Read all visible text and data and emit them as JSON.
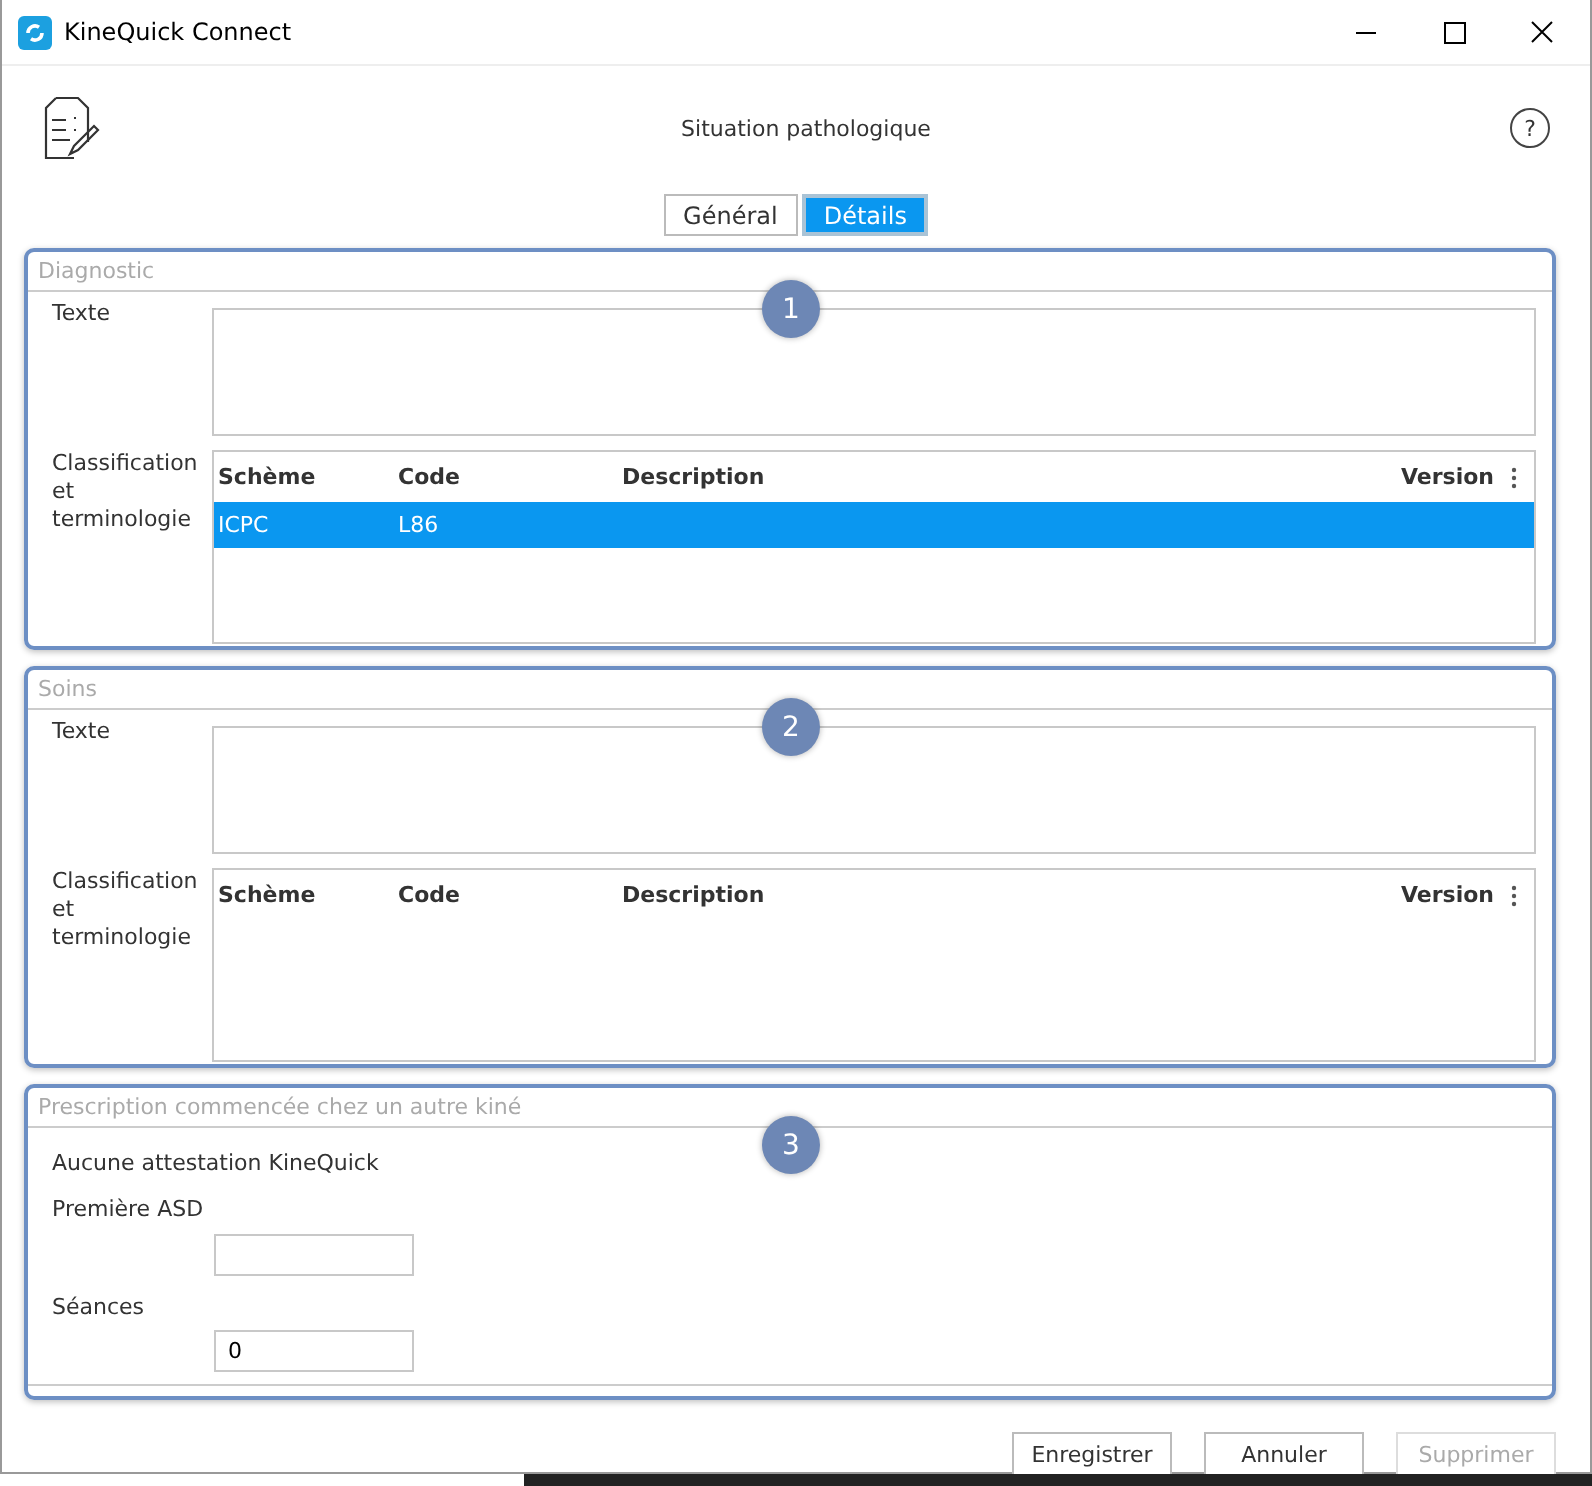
{
  "window": {
    "title": "KineQuick Connect"
  },
  "header": {
    "title": "Situation pathologique",
    "help": "?"
  },
  "tabs": [
    {
      "label": "Général",
      "selected": false
    },
    {
      "label": "Détails",
      "selected": true
    }
  ],
  "sections": [
    {
      "kind": "coded",
      "title": "Diagnostic",
      "badge": "1",
      "text_label": "Texte",
      "classification_label": "Classification et terminologie",
      "table": {
        "columns": [
          "Schème",
          "Code",
          "Description",
          "Version"
        ],
        "rows": [
          {
            "cells": [
              "ICPC",
              "L86"
            ],
            "selected": true
          }
        ]
      }
    },
    {
      "kind": "coded",
      "title": "Soins",
      "badge": "2",
      "text_label": "Texte",
      "classification_label": "Classification et terminologie",
      "table": {
        "columns": [
          "Schème",
          "Code",
          "Description",
          "Version"
        ]
      }
    },
    {
      "kind": "prescription",
      "title": "Prescription commencée chez un autre kiné",
      "badge": "3",
      "note": "Aucune attestation KineQuick",
      "fields": [
        {
          "label": "Première ASD"
        },
        {
          "label": "Séances",
          "value": "0"
        }
      ]
    }
  ],
  "buttons": [
    {
      "label": "Enregistrer",
      "disabled": false
    },
    {
      "label": "Annuler",
      "disabled": false
    },
    {
      "label": "Supprimer",
      "disabled": true
    }
  ]
}
